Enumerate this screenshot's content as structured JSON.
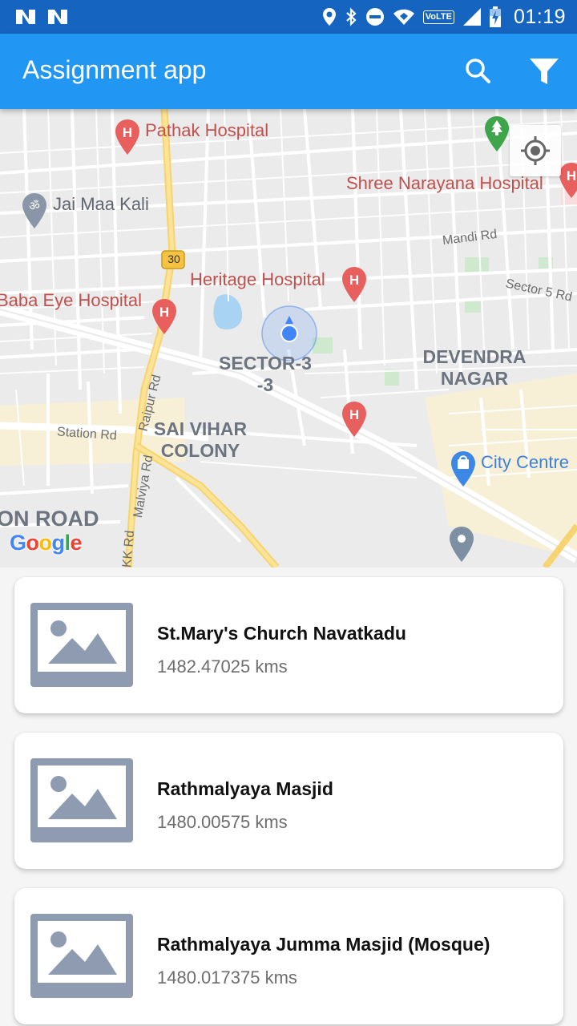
{
  "status_bar": {
    "time": "01:19",
    "network_label": "VoLTE",
    "icons": [
      "n-notification-icon",
      "n-notification-icon",
      "location-icon",
      "bluetooth-icon",
      "do-not-disturb-icon",
      "wifi-icon",
      "volte-icon",
      "signal-icon",
      "battery-charging-icon"
    ]
  },
  "app_bar": {
    "title": "Assignment app",
    "color": "#2196f3",
    "actions": [
      "search-icon",
      "filter-icon"
    ]
  },
  "map": {
    "labels": {
      "pathak": "Pathak Hospital",
      "shree": "Shree Narayana Hospital",
      "jai": "Jai Maa Kali",
      "mandi": "Mandi Rd",
      "highway": "30",
      "heritage": "Heritage Hospital",
      "sector5": "Sector 5 Rd",
      "baba": "Baba Eye Hospital",
      "sector3_line1": "SECTOR-3",
      "sector3_line2": "-3",
      "devendra_line1": "DEVENDRA",
      "devendra_line2": "NAGAR",
      "raipur": "Raipur Rd",
      "station": "Station Rd",
      "saivihar_line1": "SAI VIHAR",
      "saivihar_line2": "COLONY",
      "citycentre": "City Centre",
      "malviya": "Malviya Rd",
      "kk": "KK Rd",
      "onroad": "ON ROAD",
      "google": "Google"
    },
    "my_location_button": "my-location-icon"
  },
  "places": [
    {
      "name": "St.Mary's Church Navatkadu",
      "distance": "1482.47025 kms"
    },
    {
      "name": "Rathmalyaya Masjid",
      "distance": "1480.00575 kms"
    },
    {
      "name": "Rathmalyaya Jumma Masjid (Mosque)",
      "distance": "1480.017375 kms"
    }
  ]
}
